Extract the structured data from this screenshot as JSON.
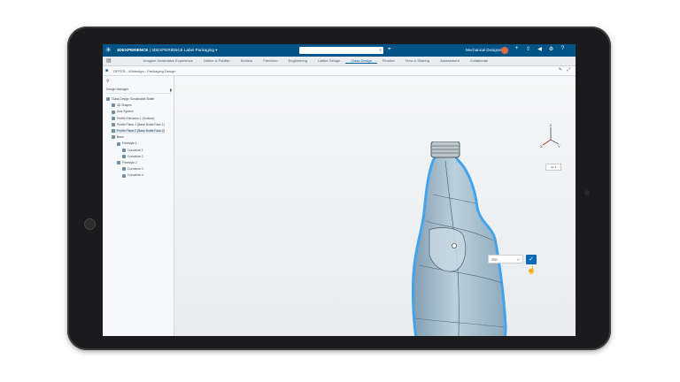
{
  "topbar": {
    "brand_bold": "3DEXPERIENCE",
    "brand_rest": " | 3DEXPERIENCE Label Packaging",
    "search_placeholder": "",
    "user": "Mechanical Designer"
  },
  "ribbon": {
    "tabs": [
      "Imagine Generative Experience",
      "Define & Publish",
      "Surface",
      "Freeform",
      "Engineering",
      "Lattice Design",
      "Class Design",
      "Finalize",
      "View & Sharing",
      "Assessment",
      "Collaborate"
    ],
    "active_tab": "Class Design"
  },
  "document": {
    "title": "OFFER - Whitesign - Packaging Design"
  },
  "tree": {
    "header": "Design Manager",
    "nodes": [
      {
        "label": "Class Design Sustainable Bottle",
        "indent": 0,
        "selected": false
      },
      {
        "label": "3D Shapes",
        "indent": 1,
        "selected": false
      },
      {
        "label": "Axis System",
        "indent": 1,
        "selected": false
      },
      {
        "label": "Profile Extrusion.1 (Surface)",
        "indent": 1,
        "selected": false
      },
      {
        "label": "Profile Plane.1 (Base Bottle Face.1)",
        "indent": 1,
        "selected": false
      },
      {
        "label": "Profile Plane.2 (Base Bottle Face.2)",
        "indent": 1,
        "selected": true
      },
      {
        "label": "Base",
        "indent": 1,
        "selected": false
      },
      {
        "label": "Freestyle.1",
        "indent": 2,
        "selected": false
      },
      {
        "label": "Curvature.1",
        "indent": 3,
        "selected": false
      },
      {
        "label": "Curvature.2",
        "indent": 3,
        "selected": false
      },
      {
        "label": "Freestyle.2",
        "indent": 2,
        "selected": false
      },
      {
        "label": "Curvature.3",
        "indent": 3,
        "selected": false
      },
      {
        "label": "Curvature.4",
        "indent": 3,
        "selected": false
      }
    ]
  },
  "viewport": {
    "input_value": "250",
    "view_select": "Iso",
    "axis": {
      "z": "Z",
      "y": "Y",
      "x": "X"
    }
  },
  "colors": {
    "topbar": "#005386",
    "accent": "#0a6ab3",
    "bottle_fill": "#a9c3d3",
    "selection_glow": "#3aa0ec"
  }
}
